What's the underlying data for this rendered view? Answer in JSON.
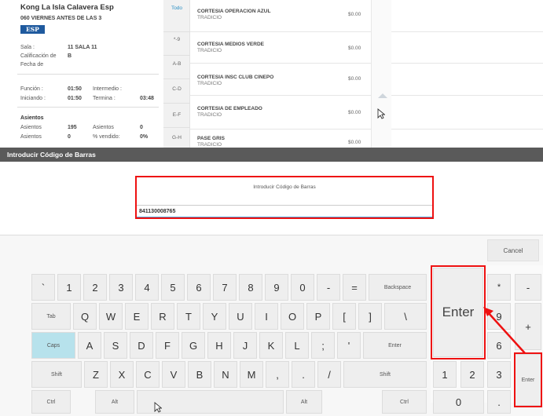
{
  "movie": {
    "title": "Kong La Isla Calavera Esp",
    "session": "060 VIERNES ANTES DE LAS 3",
    "language_badge": "ESP",
    "sala_label": "Sala :",
    "sala_value": "11  SALA 11",
    "rating_label": "Calificación de",
    "rating_value": "B",
    "date_label": "Fecha de",
    "funcion_label": "Función :",
    "funcion_value": "01:50",
    "intermedio_label": "Intermedio :",
    "iniciando_label": "Iniciando :",
    "iniciando_value": "01:50",
    "termina_label": "Termina :",
    "termina_value": "03:48",
    "asientos_heading": "Asientos",
    "asientos1_label": "Asientos",
    "asientos1_value": "195",
    "asientos2_label": "Asientos",
    "asientos2_value": "0",
    "asientos3_label": "Asientos",
    "asientos3_value": "0",
    "vendido_label": "% vendido:",
    "vendido_value": "0%"
  },
  "filters": [
    "Todo",
    "*-9",
    "A-B",
    "C-D",
    "E-F",
    "G-H"
  ],
  "tickets": [
    {
      "name": "CORTESIA OPERACION AZUL",
      "sub": "TRADICIO",
      "price": "$0.00"
    },
    {
      "name": "CORTESIA MEDIOS VERDE",
      "sub": "TRADICIO",
      "price": "$0.00"
    },
    {
      "name": "CORTESIA INSC CLUB CINEPO",
      "sub": "TRADICIO",
      "price": "$0.00"
    },
    {
      "name": "CORTESIA DE EMPLEADO",
      "sub": "TRADICIO",
      "price": "$0.00"
    },
    {
      "name": "PASE GRIS",
      "sub": "TRADICIO",
      "price": "$0.00"
    }
  ],
  "dialog": {
    "title": "Introducir Código de Barras",
    "caption": "Introducir Código de Barras",
    "barcode_value": "841130008765"
  },
  "keyboard": {
    "cancel": "Cancel",
    "row1": [
      "`",
      "1",
      "2",
      "3",
      "4",
      "5",
      "6",
      "7",
      "8",
      "9",
      "0",
      "-",
      "=",
      "Backspace"
    ],
    "row2": [
      "Tab",
      "Q",
      "W",
      "E",
      "R",
      "T",
      "Y",
      "U",
      "I",
      "O",
      "P",
      "[",
      "]",
      "\\"
    ],
    "row3": [
      "Caps",
      "A",
      "S",
      "D",
      "F",
      "G",
      "H",
      "J",
      "K",
      "L",
      ";",
      "'",
      "Enter"
    ],
    "row4": [
      "Shift",
      "Z",
      "X",
      "C",
      "V",
      "B",
      "N",
      "M",
      ",",
      ".",
      "/",
      "Shift"
    ],
    "row5": [
      "Ctrl",
      "Alt",
      "",
      "Alt",
      "Ctrl"
    ],
    "big_enter": "Enter",
    "numpad": {
      "star": "*",
      "minus": "-",
      "nine": "9",
      "plus": "+",
      "six": "6",
      "one": "1",
      "two": "2",
      "three": "3",
      "enter": "Enter",
      "zero": "0",
      "dot": "."
    }
  },
  "colors": {
    "highlight": "#e11111",
    "caps_active": "#b7e2ec",
    "badge": "#1f5a9e",
    "dialog_title_bg": "#5a5a5a"
  }
}
